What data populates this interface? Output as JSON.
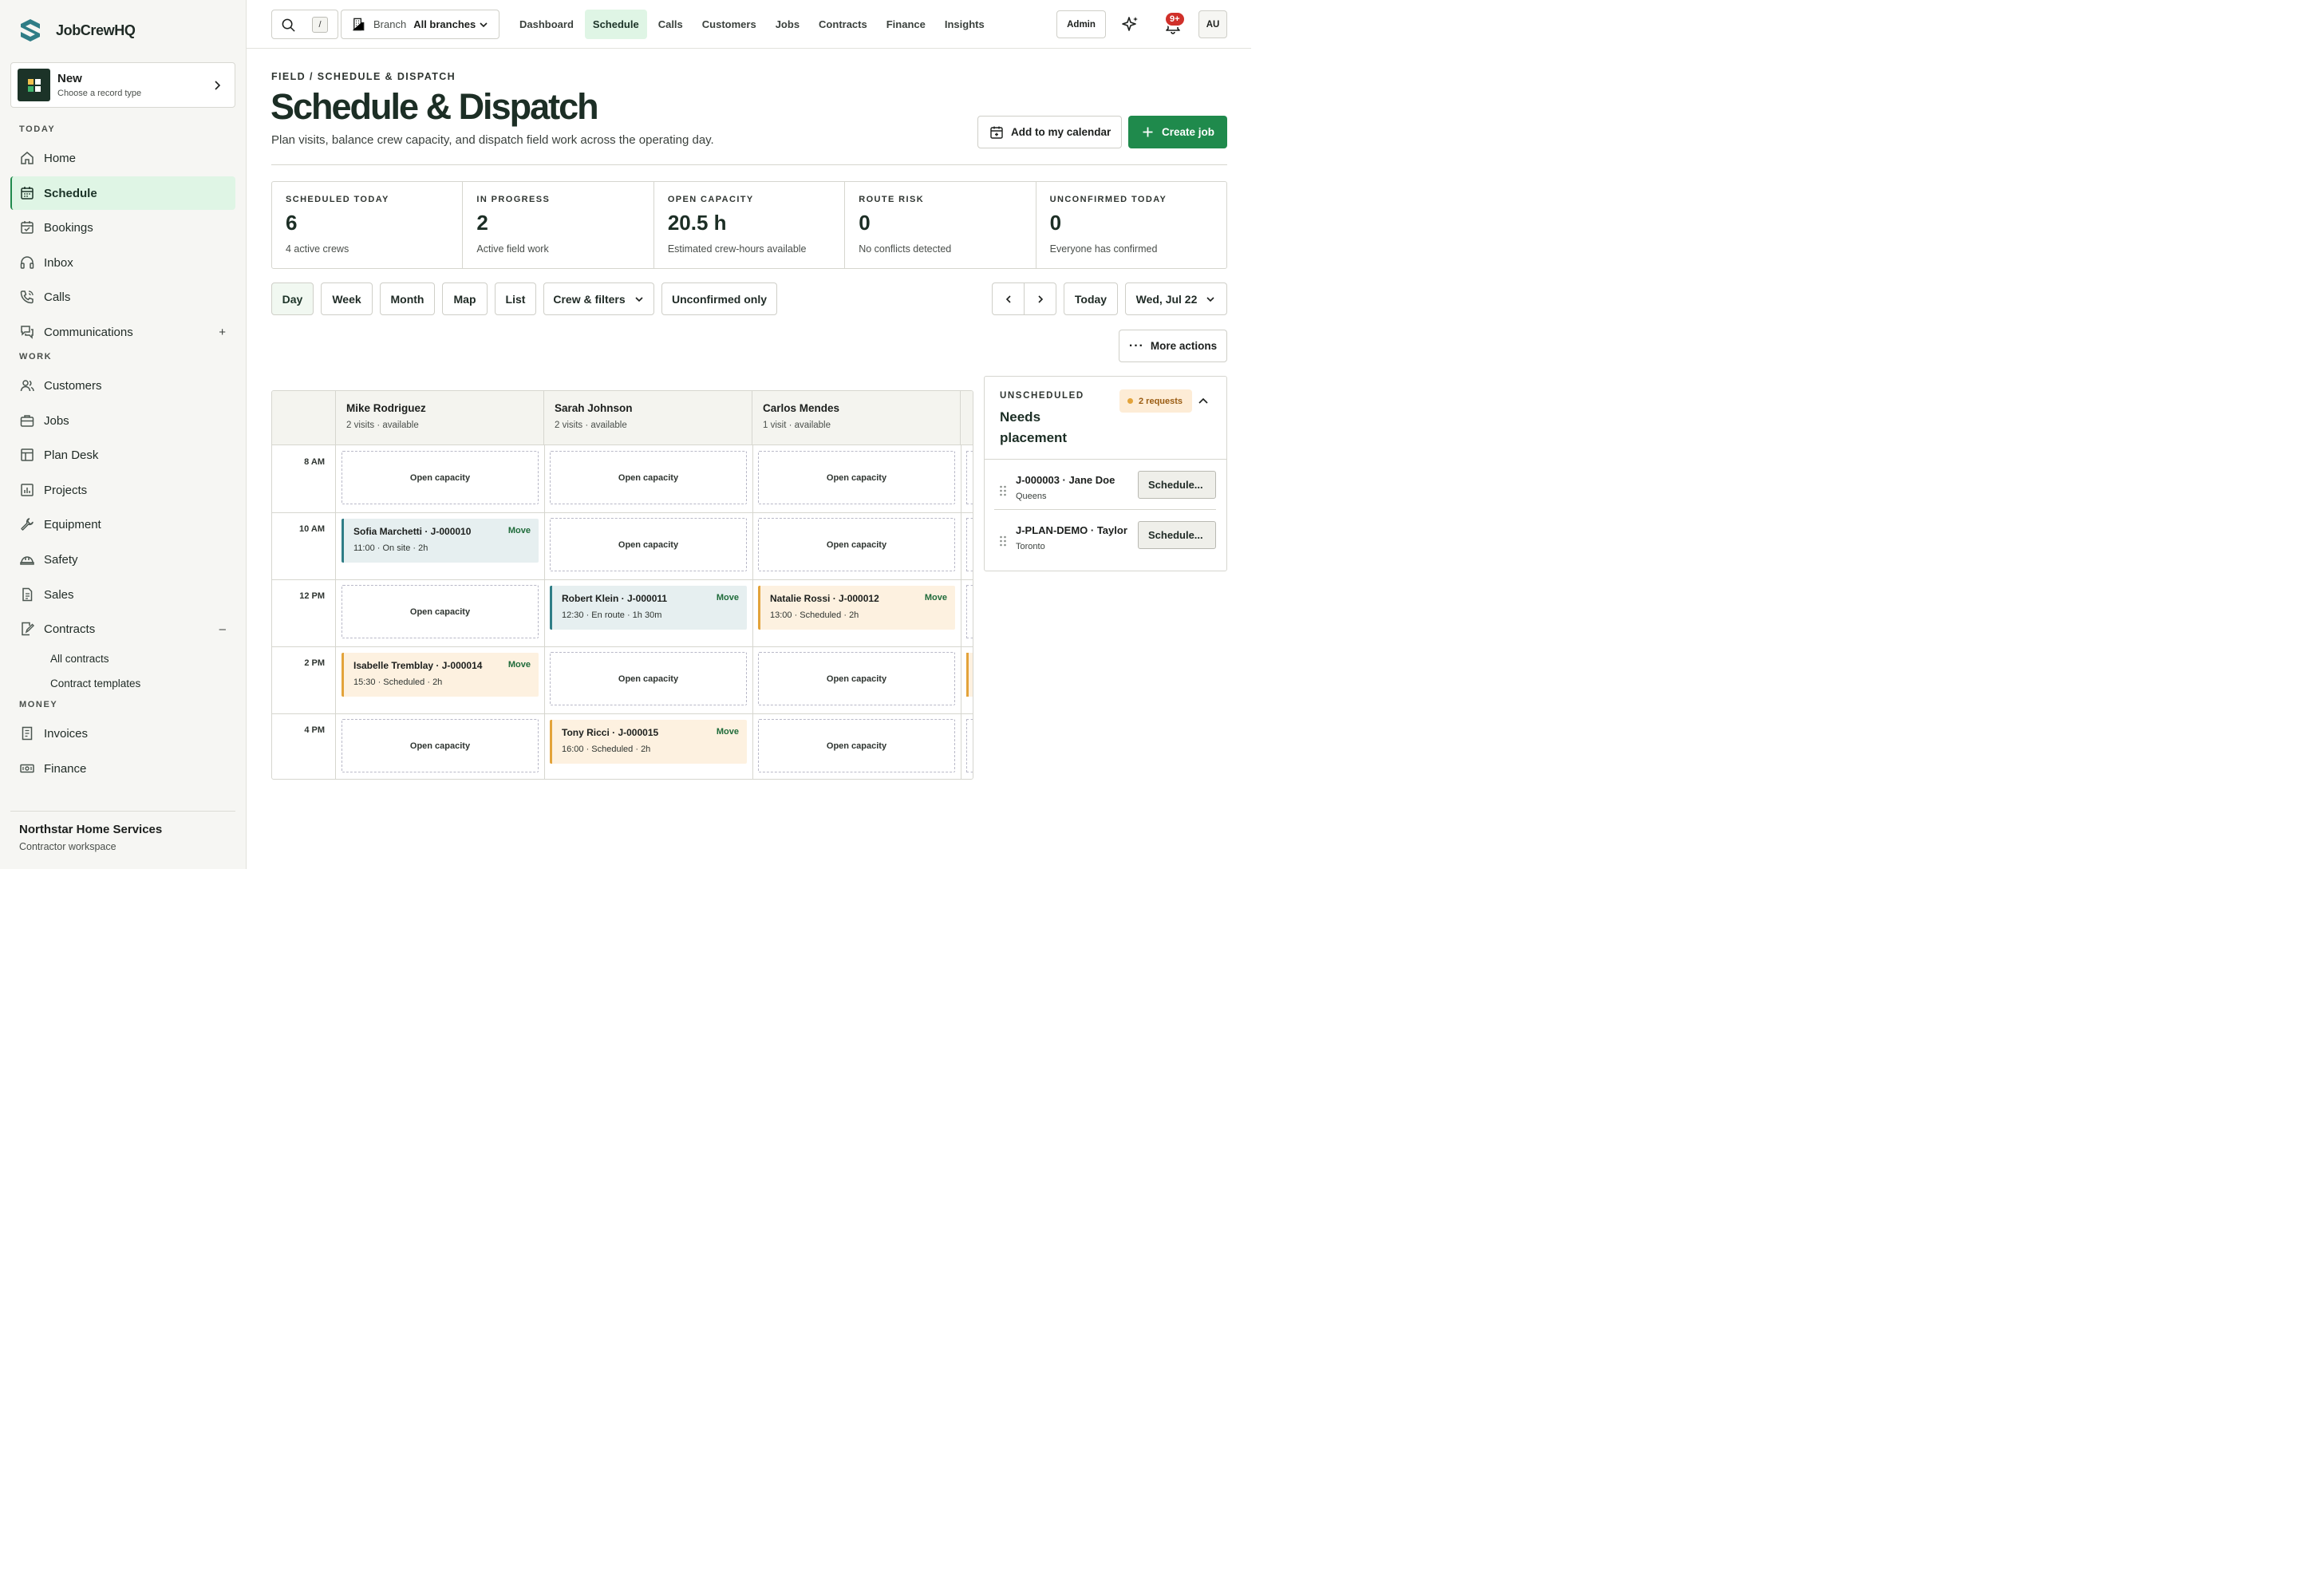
{
  "app": {
    "name": "JobCrewHQ"
  },
  "new_card": {
    "title": "New",
    "subtitle": "Choose a record type"
  },
  "sidebar": {
    "sections": {
      "today": "TODAY",
      "work": "WORK",
      "money": "MONEY"
    },
    "items": [
      {
        "label": "Home",
        "icon": "home-icon"
      },
      {
        "label": "Schedule",
        "icon": "calendar-icon",
        "active": true
      },
      {
        "label": "Bookings",
        "icon": "calendar-check-icon"
      },
      {
        "label": "Inbox",
        "icon": "headset-icon"
      },
      {
        "label": "Calls",
        "icon": "phone-icon"
      },
      {
        "label": "Communications",
        "icon": "chat-icon",
        "toggle": "+"
      },
      {
        "label": "Customers",
        "icon": "users-icon"
      },
      {
        "label": "Jobs",
        "icon": "briefcase-icon"
      },
      {
        "label": "Plan Desk",
        "icon": "layout-icon"
      },
      {
        "label": "Projects",
        "icon": "chart-icon"
      },
      {
        "label": "Equipment",
        "icon": "wrench-icon"
      },
      {
        "label": "Safety",
        "icon": "hardhat-icon"
      },
      {
        "label": "Sales",
        "icon": "document-icon"
      },
      {
        "label": "Contracts",
        "icon": "contract-icon",
        "toggle": "–"
      },
      {
        "label": "Invoices",
        "icon": "invoice-icon"
      },
      {
        "label": "Finance",
        "icon": "money-icon"
      }
    ],
    "contract_subitems": [
      "All contracts",
      "Contract templates"
    ],
    "org": {
      "name": "Northstar Home Services",
      "subtitle": "Contractor workspace"
    }
  },
  "topbar": {
    "search_shortcut": "/",
    "branch_label": "Branch",
    "branch_value": "All branches",
    "nav": [
      {
        "label": "Dashboard"
      },
      {
        "label": "Schedule",
        "active": true
      },
      {
        "label": "Calls"
      },
      {
        "label": "Customers"
      },
      {
        "label": "Jobs"
      },
      {
        "label": "Contracts"
      },
      {
        "label": "Finance"
      },
      {
        "label": "Insights"
      }
    ],
    "admin_label": "Admin",
    "notification_badge": "9+",
    "avatar_initials": "AU"
  },
  "header": {
    "breadcrumb": "FIELD / SCHEDULE & DISPATCH",
    "title": "Schedule & Dispatch",
    "subtitle": "Plan visits, balance crew capacity, and dispatch field work across the operating day.",
    "add_calendar": "Add to my calendar",
    "create_job": "Create job"
  },
  "metrics": [
    {
      "label": "SCHEDULED TODAY",
      "value": "6",
      "sub": "4 active crews"
    },
    {
      "label": "IN PROGRESS",
      "value": "2",
      "sub": "Active field work"
    },
    {
      "label": "OPEN CAPACITY",
      "value": "20.5 h",
      "sub": "Estimated crew-hours available"
    },
    {
      "label": "ROUTE RISK",
      "value": "0",
      "sub": "No conflicts detected"
    },
    {
      "label": "UNCONFIRMED TODAY",
      "value": "0",
      "sub": "Everyone has confirmed"
    }
  ],
  "toolbar": {
    "views": [
      "Day",
      "Week",
      "Month",
      "Map",
      "List"
    ],
    "active_view": "Day",
    "crew_filters": "Crew & filters",
    "unconfirmed_only": "Unconfirmed only",
    "today": "Today",
    "date": "Wed, Jul 22",
    "more_actions": "More actions"
  },
  "grid": {
    "times": [
      "8 AM",
      "10 AM",
      "12 PM",
      "2 PM",
      "4 PM"
    ],
    "open_label": "Open capacity",
    "move_label": "Move",
    "crews": [
      {
        "name": "Mike Rodriguez",
        "sub": "2 visits · available"
      },
      {
        "name": "Sarah Johnson",
        "sub": "2 visits · available"
      },
      {
        "name": "Carlos Mendes",
        "sub": "1 visit · available"
      }
    ],
    "jobs": [
      {
        "crew": 0,
        "row": 1,
        "title": "Sofia Marchetti · J-000010",
        "meta": "11:00 · On site · 2h",
        "tone": "teal"
      },
      {
        "crew": 1,
        "row": 2,
        "title": "Robert Klein · J-000011",
        "meta": "12:30 · En route · 1h 30m",
        "tone": "teal"
      },
      {
        "crew": 2,
        "row": 2,
        "title": "Natalie Rossi · J-000012",
        "meta": "13:00 · Scheduled · 2h",
        "tone": "amber"
      },
      {
        "crew": 0,
        "row": 3,
        "title": "Isabelle Tremblay · J-000014",
        "meta": "15:30 · Scheduled · 2h",
        "tone": "amber"
      },
      {
        "crew": 1,
        "row": 4,
        "title": "Tony Ricci · J-000015",
        "meta": "16:00 · Scheduled · 2h",
        "tone": "amber"
      }
    ]
  },
  "unscheduled": {
    "label": "UNSCHEDULED",
    "title": "Needs placement",
    "badge": "2 requests",
    "items": [
      {
        "title": "J-000003 · Jane Doe",
        "sub": "Queens",
        "action": "Schedule..."
      },
      {
        "title": "J-PLAN-DEMO · Taylor",
        "sub": "Toronto",
        "action": "Schedule..."
      }
    ]
  },
  "colors": {
    "brand_green": "#1f8a4c",
    "active_bg": "#dff5e5",
    "teal": "#2f7d86",
    "amber": "#e3a33a",
    "badge_red": "#d0302a"
  }
}
